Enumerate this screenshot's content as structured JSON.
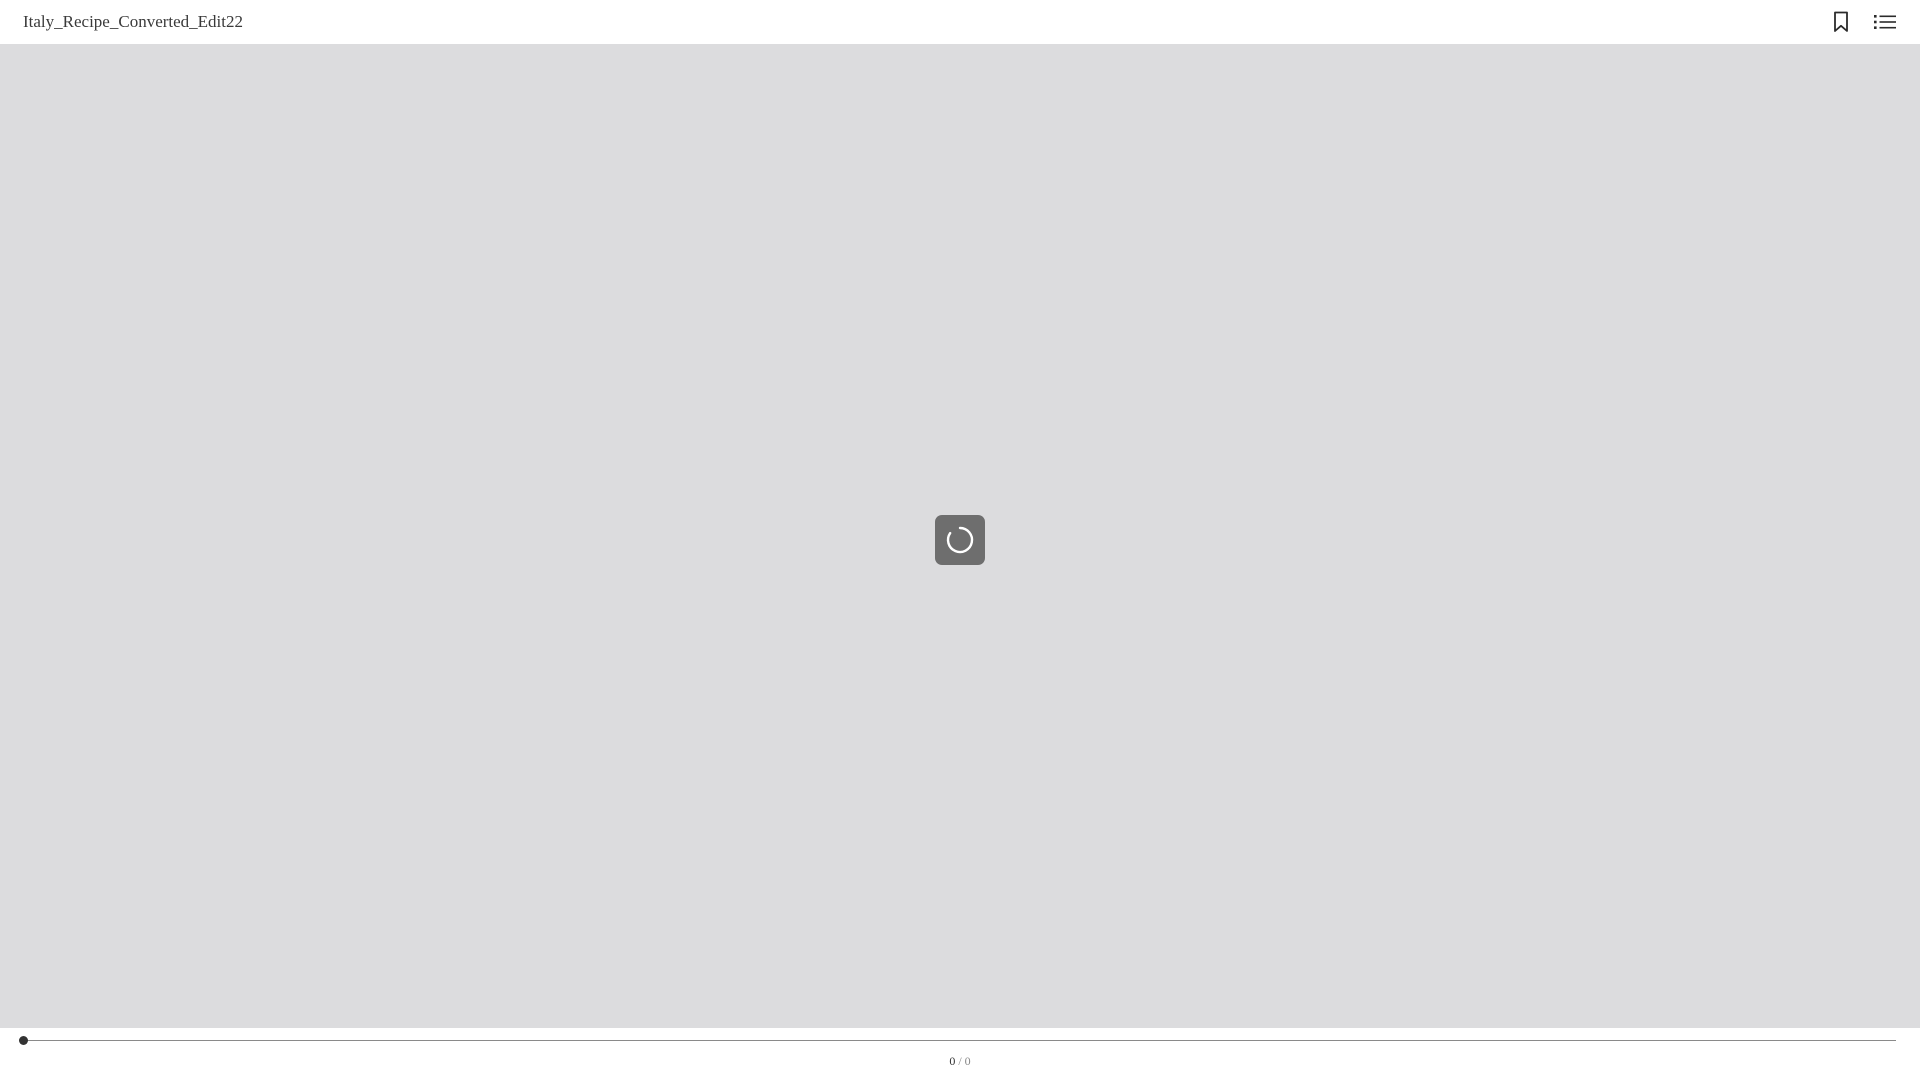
{
  "header": {
    "title": "Italy_Recipe_Converted_Edit22",
    "icons": [
      "bookmark-icon",
      "table-of-contents-icon"
    ]
  },
  "viewer": {
    "state": "loading",
    "background_color": "#dcdcde",
    "spinner_icon": "loading-spinner-icon"
  },
  "footer": {
    "current_page": "0",
    "separator": " / ",
    "total_pages": "0",
    "progress": 0
  }
}
